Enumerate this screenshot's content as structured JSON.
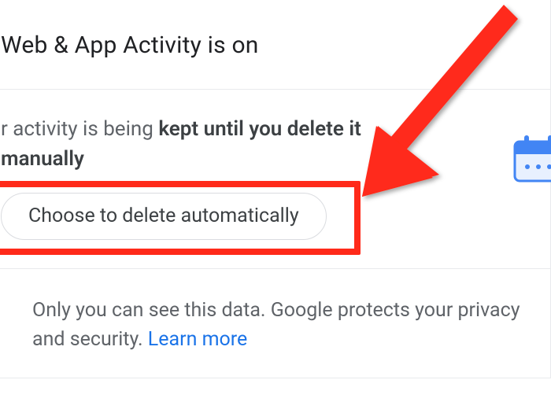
{
  "header": {
    "title": "Web & App Activity is on"
  },
  "activity": {
    "prefix": "r activity is being ",
    "bold_part": "kept until you delete it manually",
    "button_label": "Choose to delete automatically"
  },
  "privacy": {
    "text": "Only you can see this data. Google protects your privacy and security. ",
    "learn_more_label": "Learn more"
  },
  "icons": {
    "calendar": "calendar-icon",
    "shield": "shield-icon",
    "arrow": "arrow-annotation"
  },
  "colors": {
    "highlight": "#ff2a1a",
    "link": "#1a73e8",
    "text_primary": "#202124",
    "text_secondary": "#5f6368",
    "calendar_blue": "#4285f4"
  }
}
